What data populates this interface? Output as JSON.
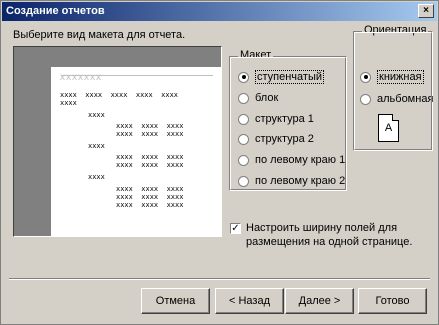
{
  "window": {
    "title": "Создание отчетов",
    "close_glyph": "×"
  },
  "prompt": "Выберите вид макета для отчета.",
  "preview": {
    "header": "xxxxxxx",
    "col_headers": "xxxx  xxxx  xxxx  xxxx  xxxx",
    "rows": [
      "xxxx",
      "xxxx",
      "xxxx  xxxx  xxxx",
      "xxxx  xxxx  xxxx",
      "xxxx",
      "xxxx  xxxx  xxxx",
      "xxxx  xxxx  xxxx",
      "xxxx",
      "xxxx  xxxx  xxxx",
      "xxxx  xxxx  xxxx",
      "xxxx  xxxx  xxxx"
    ]
  },
  "layout_group": {
    "title": "Макет",
    "options": [
      {
        "label": "ступенчатый",
        "selected": true
      },
      {
        "label": "блок",
        "selected": false
      },
      {
        "label": "структура 1",
        "selected": false
      },
      {
        "label": "структура 2",
        "selected": false
      },
      {
        "label": "по левому краю 1",
        "selected": false
      },
      {
        "label": "по левому краю 2",
        "selected": false
      }
    ]
  },
  "orientation_group": {
    "title": "Ориентация",
    "options": [
      {
        "label": "книжная",
        "selected": true
      },
      {
        "label": "альбомная",
        "selected": false
      }
    ],
    "page_icon_letter": "A"
  },
  "fit_checkbox": {
    "checked": true,
    "label": "Настроить ширину полей для размещения на одной странице.",
    "check_glyph": "✓"
  },
  "buttons": {
    "cancel": "Отмена",
    "back": "< Назад",
    "next": "Далее >",
    "finish": "Готово"
  }
}
